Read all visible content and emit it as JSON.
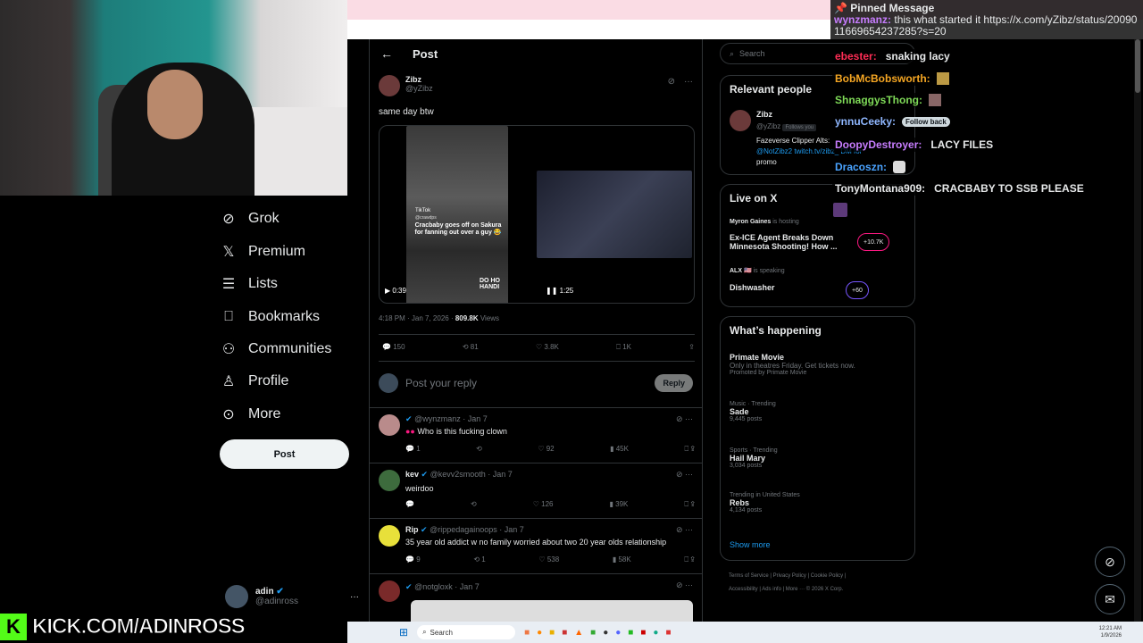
{
  "nav": {
    "items": [
      {
        "icon": "grok-icon",
        "label": "Grok"
      },
      {
        "icon": "x-premium-icon",
        "label": "Premium"
      },
      {
        "icon": "lists-icon",
        "label": "Lists"
      },
      {
        "icon": "bookmark-icon",
        "label": "Bookmarks"
      },
      {
        "icon": "communities-icon",
        "label": "Communities"
      },
      {
        "icon": "profile-icon",
        "label": "Profile"
      },
      {
        "icon": "more-icon",
        "label": "More"
      }
    ],
    "post_label": "Post"
  },
  "account": {
    "name": "adin",
    "handle": "@adinross",
    "menu": "···"
  },
  "header": {
    "title": "Post",
    "back": "←"
  },
  "post": {
    "author": "Zibz",
    "handle": "@yZibz",
    "text": "same day btw",
    "video1": {
      "duration": "0:39",
      "tiktok": "TikTok",
      "overlay": "Cracbaby goes off on Sakura for fanning out over a guy 😂",
      "handle_small": "@crawdps",
      "corner": "DO HO HANDI"
    },
    "video2": {
      "duration": "1:25"
    },
    "time": "4:18 PM · Jan 7, 2026 · ",
    "views": "809.8K",
    " views_label": "Views",
    "views_label": "Views",
    "stats": {
      "replies": "150",
      "reposts": "81",
      "likes": "3.8K",
      "bookmarks": "1K"
    }
  },
  "reply_box": {
    "placeholder": "Post your reply",
    "button": "Reply"
  },
  "replies": [
    {
      "name": "",
      "handle": "@wynzmanz",
      "date": "· Jan 7",
      "text": "Who is this fucking clown",
      "replies": "1",
      "reposts": "",
      "likes": "92",
      "views": "45K"
    },
    {
      "name": "kev",
      "handle": "@kevv2smooth",
      "date": "· Jan 7",
      "text": "weirdoo",
      "replies": "",
      "reposts": "",
      "likes": "126",
      "views": "39K"
    },
    {
      "name": "Rip",
      "handle": "@rippedagainoops",
      "date": "· Jan 7",
      "text": "35 year old addict w no family worried about two 20 year olds relationship",
      "replies": "9",
      "reposts": "1",
      "likes": "538",
      "views": "58K"
    },
    {
      "name": "",
      "handle": "@notgloxk",
      "date": "· Jan 7",
      "text": "",
      "replies": "",
      "reposts": "",
      "likes": "",
      "views": ""
    }
  ],
  "search": {
    "placeholder": "Search"
  },
  "relevant": {
    "title": "Relevant people",
    "name": "Zibz",
    "handle": "@yZibz",
    "follows": "Follows you",
    "bio1": "Fazeverse Clipper Alts:",
    "bio2": "@NotZibz2 twitch.tv/zibz_ DM for",
    "bio3": "promo"
  },
  "live": {
    "title": "Live on X",
    "items": [
      {
        "host": "Myron Gaines",
        "status": "is hosting",
        "title": "Ex-ICE Agent Breaks Down Minnesota Shooting! How ...",
        "count": "+10.7K"
      },
      {
        "host": "ALX 🇺🇸",
        "status": "is speaking",
        "title": "Dishwasher",
        "count": "+60"
      }
    ]
  },
  "happening": {
    "title": "What’s happening",
    "items": [
      {
        "meta": "Primate Movie",
        "title": "Only in theatres Friday. Get tickets now.",
        "sub": "Promoted by Primate Movie"
      },
      {
        "meta": "Music · Trending",
        "title": "Sade",
        "sub": "9,445 posts"
      },
      {
        "meta": "Sports · Trending",
        "title": "Hail Mary",
        "sub": "3,034 posts"
      },
      {
        "meta": "Trending in United States",
        "title": "Rebs",
        "sub": "4,134 posts"
      }
    ],
    "show_more": "Show more"
  },
  "footer": {
    "line1": "Terms of Service  |  Privacy Policy  |  Cookie Policy  |",
    "line2": "Accessibility  |  Ads info  |  More ···  © 2026 X Corp."
  },
  "chat": {
    "pinned_title": "Pinned Message",
    "pinned_user": "wynzmanz:",
    "pinned_text": "this what started it https://x.com/yZibz/status/2009011669654237285?s=20",
    "lines": [
      {
        "user": "ebester:",
        "msg": "snaking lacy",
        "color": "#ff2d55"
      },
      {
        "user": "BobMcBobsworth:",
        "msg": "",
        "color": "#f5a623"
      },
      {
        "user": "ShnaggysThong:",
        "msg": "",
        "color": "#7ed957"
      },
      {
        "user": "ynnuCeeky:",
        "msg": "",
        "color": "#8fb7ff"
      },
      {
        "user": "DoopyDestroyer:",
        "msg": "LACY FILES",
        "color": "#c77dff"
      },
      {
        "user": "Dracoszn:",
        "msg": "",
        "color": "#4aa3ff"
      },
      {
        "user": "TonyMontana909:",
        "msg": "CRACBABY TO SSB PLEASE",
        "color": "#e7e9ea"
      }
    ],
    "follow_back": "Follow back"
  },
  "brand": {
    "kick": "KICK.COM/ADINROSS",
    "kick_color": "#53fc18"
  },
  "taskbar": {
    "search": "Search",
    "time": "12:21 AM",
    "date": "1/9/2026"
  }
}
